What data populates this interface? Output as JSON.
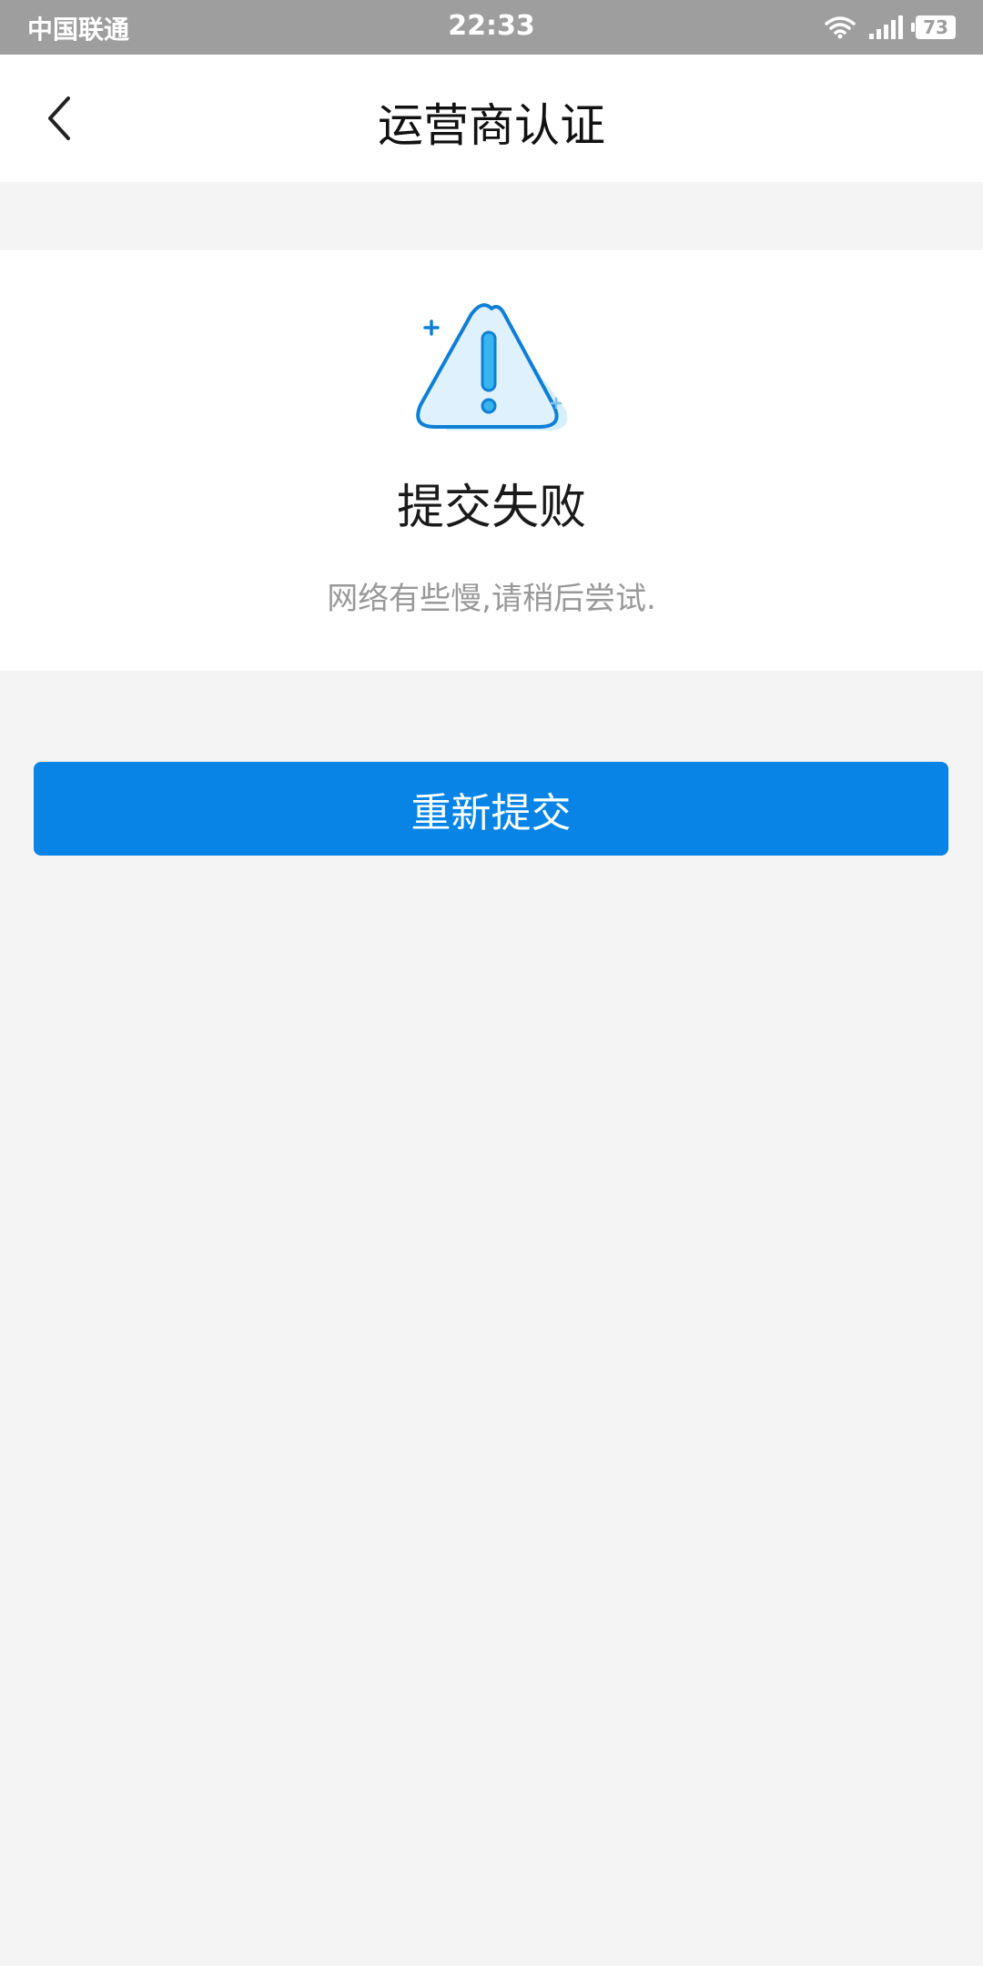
{
  "status_bar": {
    "carrier": "中国联通",
    "time": "22:33",
    "battery": "73",
    "icons": [
      "wifi-icon",
      "signal-icon",
      "battery-icon"
    ]
  },
  "nav": {
    "title": "运营商认证",
    "back_icon": "chevron-left-icon"
  },
  "result": {
    "icon": "warning-triangle-icon",
    "title": "提交失败",
    "description": "网络有些慢,请稍后尝试."
  },
  "actions": {
    "resubmit_label": "重新提交"
  },
  "colors": {
    "primary": "#0784e6",
    "status_bar": "#9e9e9e",
    "background": "#f4f4f4",
    "icon_fill": "#d6effc"
  }
}
